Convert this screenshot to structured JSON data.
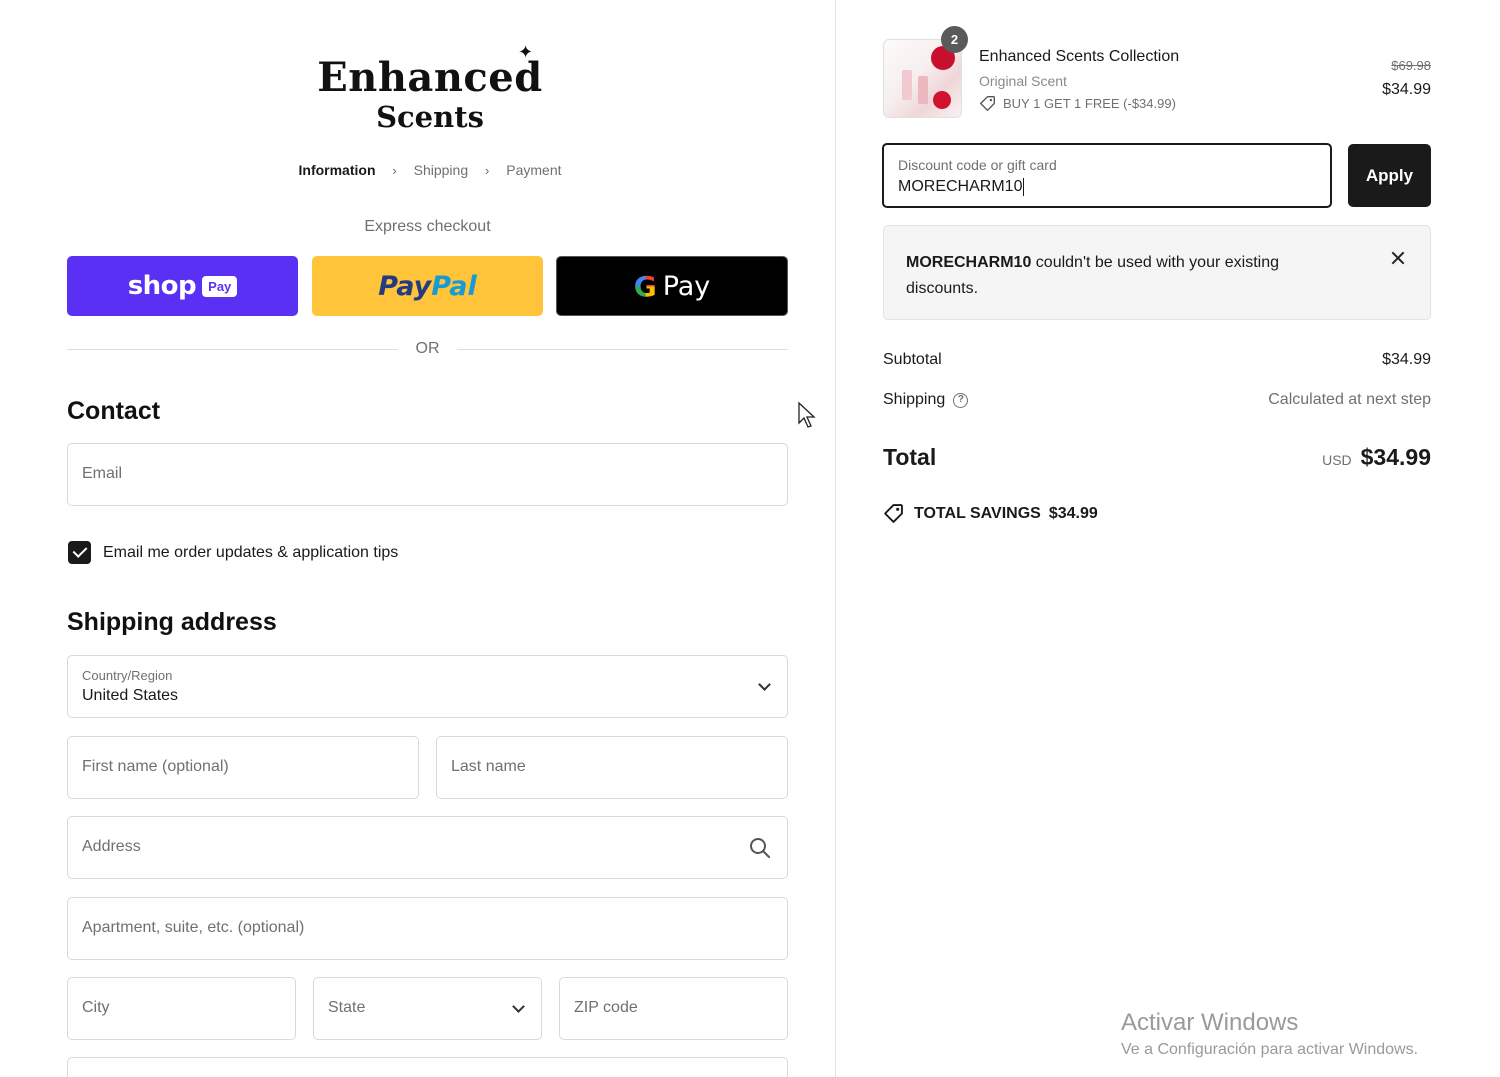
{
  "brand": {
    "line1": "Enhanced",
    "line2": "Scents",
    "star": "✦"
  },
  "breadcrumb": {
    "items": [
      "Information",
      "Shipping",
      "Payment"
    ],
    "separator": "›"
  },
  "express": {
    "label": "Express checkout",
    "shop_word": "shop",
    "shop_badge": "Pay",
    "paypal_pay": "Pay",
    "paypal_pal": "Pal",
    "gpay_g": "G",
    "gpay_word": "Pay",
    "or": "OR"
  },
  "contact": {
    "title": "Contact",
    "email_placeholder": "Email",
    "marketing_label": "Email me order updates & application tips",
    "marketing_checked": true
  },
  "shipping_address": {
    "title": "Shipping address",
    "country_label": "Country/Region",
    "country_value": "United States",
    "first_name_placeholder": "First name (optional)",
    "last_name_placeholder": "Last name",
    "address_placeholder": "Address",
    "apartment_placeholder": "Apartment, suite, etc. (optional)",
    "city_placeholder": "City",
    "state_placeholder": "State",
    "zip_placeholder": "ZIP code"
  },
  "order": {
    "product": {
      "quantity": "2",
      "name": "Enhanced Scents Collection",
      "variant": "Original Scent",
      "discount": "BUY 1 GET 1 FREE (-$34.99)",
      "original_price": "$69.98",
      "price": "$34.99"
    },
    "discount_field": {
      "label": "Discount code or gift card",
      "value": "MORECHARM10"
    },
    "apply_label": "Apply",
    "error": {
      "code": "MORECHARM10",
      "message": " couldn't be used with your existing discounts."
    },
    "subtotal_label": "Subtotal",
    "subtotal_value": "$34.99",
    "shipping_label": "Shipping",
    "shipping_value": "Calculated at next step",
    "total_label": "Total",
    "total_currency": "USD",
    "total_value": "$34.99",
    "savings_label": "TOTAL SAVINGS",
    "savings_value": "$34.99"
  },
  "watermark": {
    "title": "Activar Windows",
    "subtitle": "Ve a Configuración para activar Windows."
  },
  "colors": {
    "shop_pay": "#5a31f4",
    "paypal": "#ffc439",
    "gpay": "#000000",
    "apply": "#1a1a1a"
  }
}
